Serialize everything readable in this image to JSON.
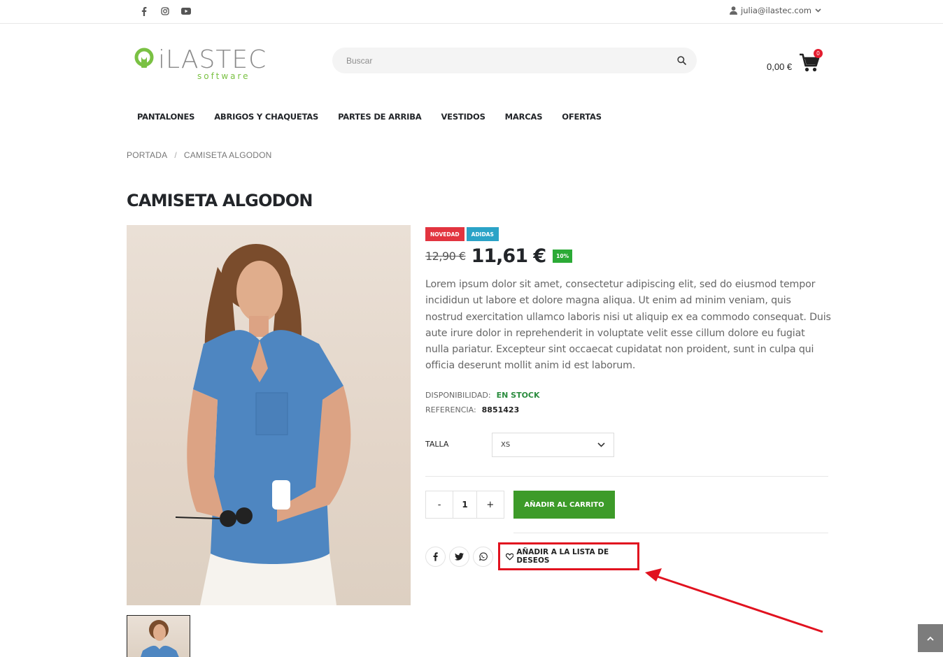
{
  "topbar": {
    "social": [
      "facebook-icon",
      "instagram-icon",
      "youtube-icon"
    ],
    "account_email": "julia@ilastec.com"
  },
  "header": {
    "logo_text": "iLASTEC",
    "logo_subtext": "software",
    "search_placeholder": "Buscar",
    "cart_total": "0,00 €",
    "cart_count": "0"
  },
  "nav": {
    "items": [
      "PANTALONES",
      "ABRIGOS Y CHAQUETAS",
      "PARTES DE ARRIBA",
      "VESTIDOS",
      "MARCAS",
      "OFERTAS"
    ]
  },
  "breadcrumb": {
    "home": "PORTADA",
    "separator": "/",
    "current": "CAMISETA ALGODON"
  },
  "product": {
    "title": "CAMISETA ALGODON",
    "badges": {
      "new": "NOVEDAD",
      "brand": "ADIDAS"
    },
    "old_price": "12,90 €",
    "price": "11,61 €",
    "discount": "10%",
    "description": "Lorem ipsum dolor sit amet, consectetur adipiscing elit, sed do eiusmod tempor incididun ut labore et dolore magna aliqua. Ut enim ad minim veniam, quis nostrud exercitation ullamco laboris nisi ut aliquip ex ea commodo consequat. Duis aute irure dolor in reprehenderit in voluptate velit esse cillum dolore eu fugiat nulla pariatur. Excepteur sint occaecat cupidatat non proident, sunt in culpa qui officia deserunt mollit anim id est laborum.",
    "availability_label": "DISPONIBILIDAD:",
    "availability_value": "EN STOCK",
    "reference_label": "REFERENCIA:",
    "reference_value": "8851423",
    "size_label": "TALLA",
    "size_value": "XS",
    "qty_minus": "-",
    "qty_value": "1",
    "qty_plus": "+",
    "add_to_cart": "AÑADIR AL CARRITO",
    "wishlist": "AÑADIR A LA LISTA DE DESEOS",
    "share": [
      "facebook-icon",
      "twitter-icon",
      "whatsapp-icon"
    ]
  },
  "colors": {
    "accent_green": "#3d9b29",
    "badge_new": "#e2343f",
    "badge_brand": "#2ba3c7",
    "discount": "#2baa36",
    "stock_green": "#2a8c3e",
    "annotation_red": "#e1121f"
  }
}
